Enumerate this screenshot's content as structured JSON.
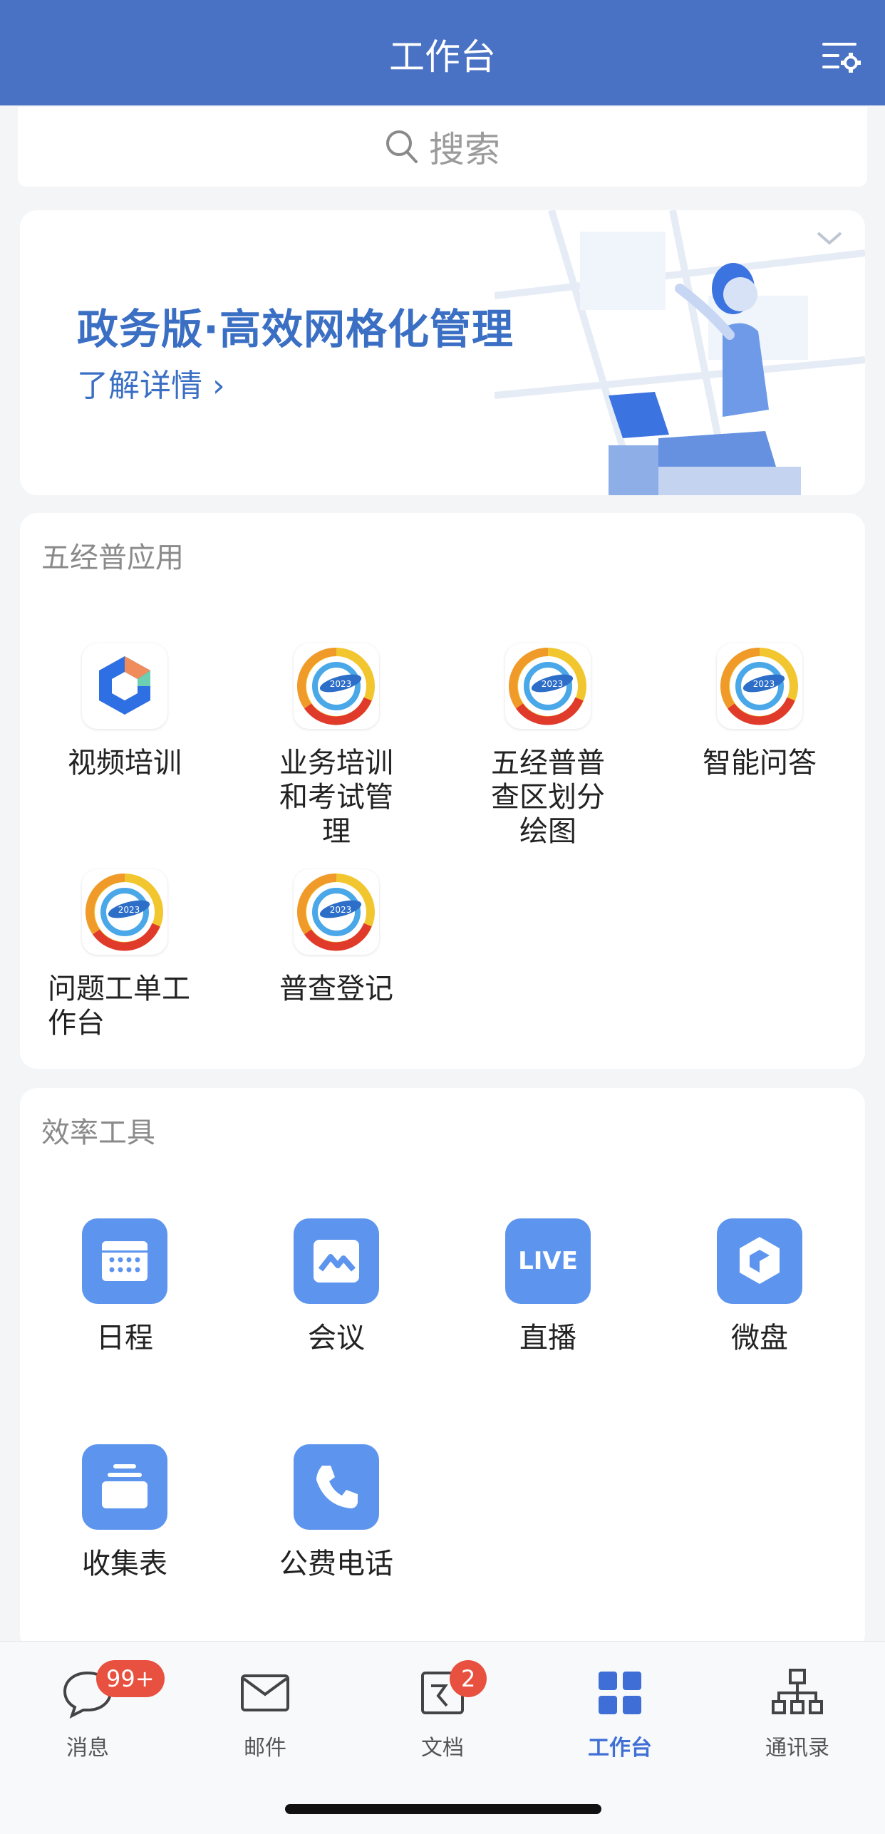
{
  "header": {
    "title": "工作台"
  },
  "search": {
    "placeholder": "搜索"
  },
  "banner": {
    "title": "政务版·高效网格化管理",
    "link": "了解详情 ›"
  },
  "sections": {
    "wujingpu": {
      "title": "五经普应用",
      "apps": [
        {
          "label": "视频培训",
          "icon": "cube-logo-icon"
        },
        {
          "label": "业务培训和考试管理",
          "icon": "census-2023-logo-icon"
        },
        {
          "label": "五经普普查区划分绘图",
          "icon": "census-2023-logo-icon"
        },
        {
          "label": "智能问答",
          "icon": "census-2023-logo-icon"
        },
        {
          "label": "问题工单工作台",
          "icon": "census-2023-logo-icon"
        },
        {
          "label": "普查登记",
          "icon": "census-2023-logo-icon"
        }
      ]
    },
    "efficiency": {
      "title": "效率工具",
      "apps": [
        {
          "label": "日程",
          "icon": "calendar-icon"
        },
        {
          "label": "会议",
          "icon": "meeting-icon"
        },
        {
          "label": "直播",
          "icon": "live-icon",
          "icon_text": "LIVE"
        },
        {
          "label": "微盘",
          "icon": "drive-icon"
        },
        {
          "label": "收集表",
          "icon": "form-collect-icon"
        },
        {
          "label": "公费电话",
          "icon": "phone-icon"
        }
      ]
    }
  },
  "tabbar": {
    "items": [
      {
        "label": "消息",
        "icon": "chat-bubble-icon",
        "badge": "99+"
      },
      {
        "label": "邮件",
        "icon": "mail-icon"
      },
      {
        "label": "文档",
        "icon": "document-icon",
        "badge": "2"
      },
      {
        "label": "工作台",
        "icon": "grid-apps-icon",
        "active": true
      },
      {
        "label": "通讯录",
        "icon": "org-chart-icon"
      }
    ]
  },
  "colors": {
    "header": "#4a72c4",
    "accent": "#3f6fd6",
    "tool_blue": "#5d95ee",
    "badge": "#e8503f"
  }
}
